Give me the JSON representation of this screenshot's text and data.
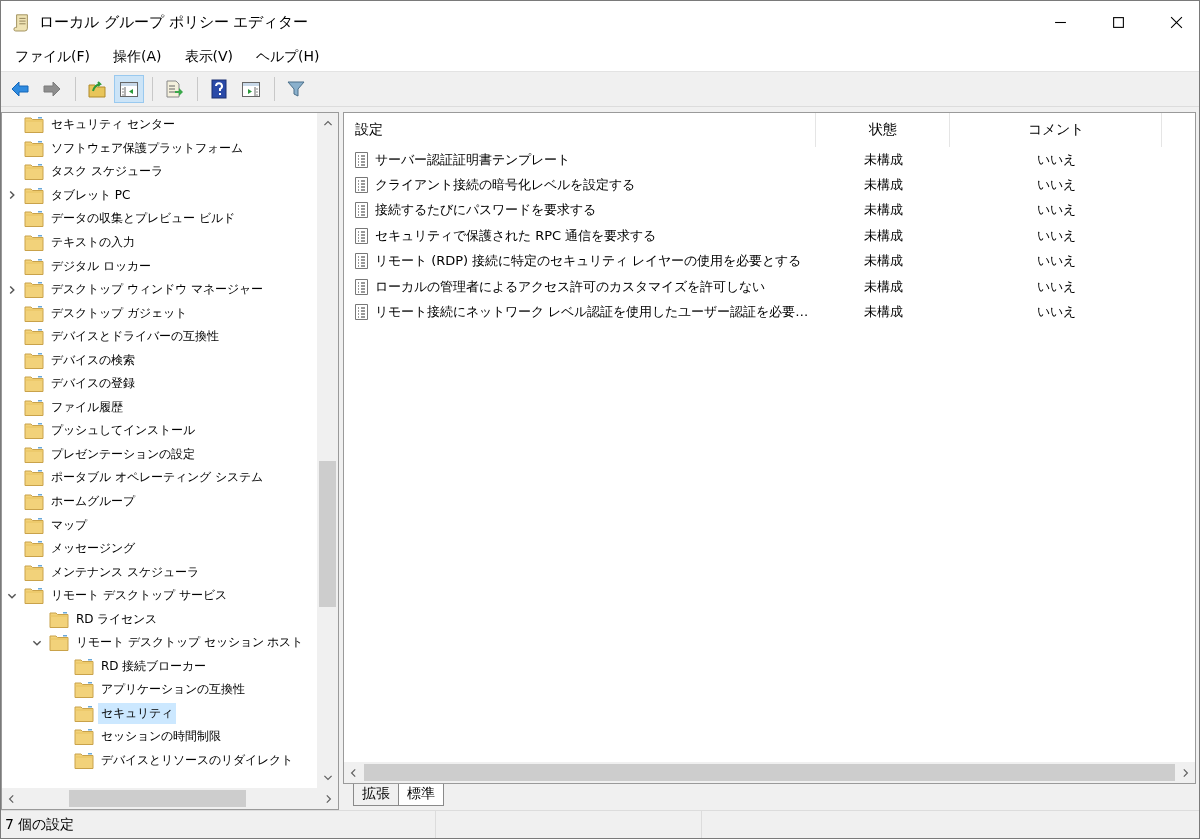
{
  "window": {
    "title": "ローカル グループ ポリシー エディター"
  },
  "menu": [
    {
      "label": "ファイル(F)"
    },
    {
      "label": "操作(A)"
    },
    {
      "label": "表示(V)"
    },
    {
      "label": "ヘルプ(H)"
    }
  ],
  "toolbar": [
    [
      {
        "kind": "back",
        "disabled": false,
        "pressed": false
      },
      {
        "kind": "forward",
        "disabled": true,
        "pressed": false
      }
    ],
    [
      {
        "kind": "up",
        "disabled": false,
        "pressed": false
      },
      {
        "kind": "tree",
        "disabled": false,
        "pressed": true
      }
    ],
    [
      {
        "kind": "export",
        "disabled": false,
        "pressed": false
      }
    ],
    [
      {
        "kind": "help",
        "disabled": false,
        "pressed": false
      },
      {
        "kind": "action",
        "disabled": false,
        "pressed": false
      }
    ],
    [
      {
        "kind": "filter",
        "disabled": false,
        "pressed": false
      }
    ]
  ],
  "tree": [
    {
      "label": "セキュリティ センター",
      "selected": false
    },
    {
      "label": "ソフトウェア保護プラットフォーム",
      "selected": false
    },
    {
      "label": "タスク スケジューラ",
      "selected": false
    },
    {
      "label": "タブレット PC",
      "selected": false,
      "expanded": false
    },
    {
      "label": "データの収集とプレビュー ビルド",
      "selected": false
    },
    {
      "label": "テキストの入力",
      "selected": false
    },
    {
      "label": "デジタル ロッカー",
      "selected": false
    },
    {
      "label": "デスクトップ ウィンドウ マネージャー",
      "selected": false,
      "expanded": false
    },
    {
      "label": "デスクトップ ガジェット",
      "selected": false
    },
    {
      "label": "デバイスとドライバーの互換性",
      "selected": false
    },
    {
      "label": "デバイスの検索",
      "selected": false
    },
    {
      "label": "デバイスの登録",
      "selected": false
    },
    {
      "label": "ファイル履歴",
      "selected": false
    },
    {
      "label": "プッシュしてインストール",
      "selected": false
    },
    {
      "label": "プレゼンテーションの設定",
      "selected": false
    },
    {
      "label": "ポータブル オペレーティング システム",
      "selected": false
    },
    {
      "label": "ホームグループ",
      "selected": false
    },
    {
      "label": "マップ",
      "selected": false
    },
    {
      "label": "メッセージング",
      "selected": false
    },
    {
      "label": "メンテナンス スケジューラ",
      "selected": false
    },
    {
      "label": "リモート デスクトップ サービス",
      "selected": false,
      "expanded": true,
      "children": [
        {
          "label": "RD ライセンス",
          "selected": false
        },
        {
          "label": "リモート デスクトップ セッション ホスト",
          "selected": false,
          "expanded": true,
          "children": [
            {
              "label": "RD 接続ブローカー",
              "selected": false
            },
            {
              "label": "アプリケーションの互換性",
              "selected": false
            },
            {
              "label": "セキュリティ",
              "selected": true
            },
            {
              "label": "セッションの時間制限",
              "selected": false
            },
            {
              "label": "デバイスとリソースのリダイレクト",
              "selected": false
            }
          ]
        }
      ]
    }
  ],
  "table": {
    "columns": [
      "設定",
      "状態",
      "コメント"
    ],
    "rows": [
      [
        "サーバー認証証明書テンプレート",
        "未構成",
        "いいえ"
      ],
      [
        "クライアント接続の暗号化レベルを設定する",
        "未構成",
        "いいえ"
      ],
      [
        "接続するたびにパスワードを要求する",
        "未構成",
        "いいえ"
      ],
      [
        "セキュリティで保護された RPC 通信を要求する",
        "未構成",
        "いいえ"
      ],
      [
        "リモート (RDP) 接続に特定のセキュリティ レイヤーの使用を必要とする",
        "未構成",
        "いいえ"
      ],
      [
        "ローカルの管理者によるアクセス許可のカスタマイズを許可しない",
        "未構成",
        "いいえ"
      ],
      [
        "リモート接続にネットワーク レベル認証を使用したユーザー認証を必要…",
        "未構成",
        "いいえ"
      ]
    ]
  },
  "view_tabs": [
    {
      "label": "拡張",
      "selected": false
    },
    {
      "label": "標準",
      "selected": true
    }
  ],
  "status_bar": {
    "text": "7 個の設定"
  }
}
